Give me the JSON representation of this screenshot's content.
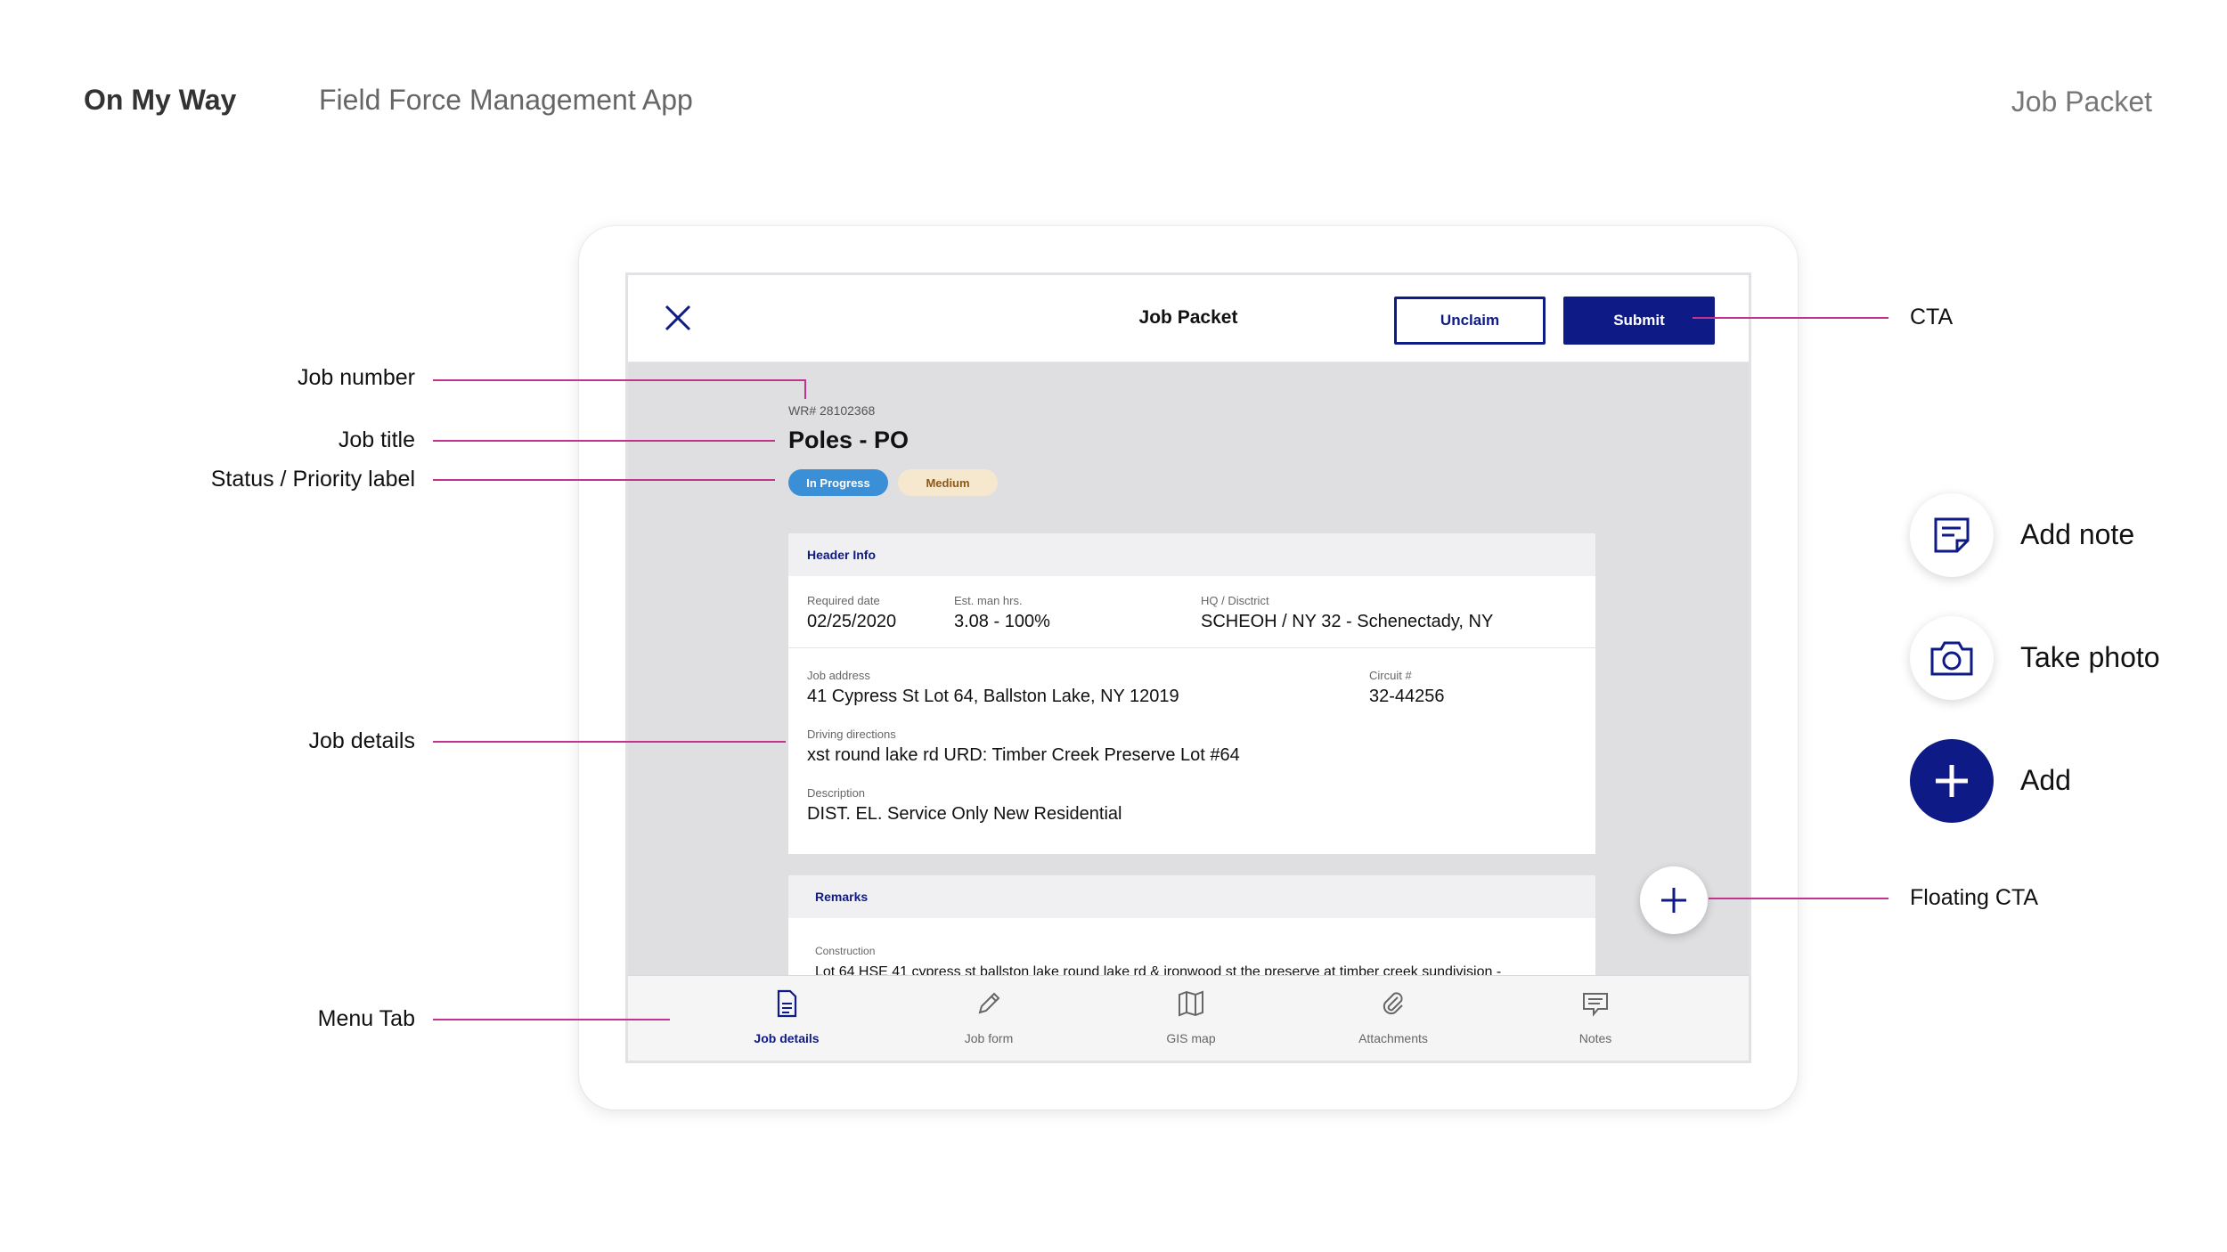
{
  "presentation": {
    "brand": "On My Way",
    "subtitle": "Field Force Management App",
    "section": "Job Packet"
  },
  "app": {
    "topbar": {
      "title": "Job Packet",
      "unclaim_label": "Unclaim",
      "submit_label": "Submit"
    },
    "job": {
      "number": "WR# 28102368",
      "title": "Poles - PO",
      "status": "In Progress",
      "priority": "Medium"
    },
    "header_info": {
      "title": "Header Info",
      "required_date_label": "Required date",
      "required_date": "02/25/2020",
      "man_hrs_label": "Est. man hrs.",
      "man_hrs": "3.08 - 100%",
      "hq_label": "HQ / Disctrict",
      "hq": "SCHEOH / NY 32 - Schenectady, NY",
      "address_label": "Job address",
      "address": "41 Cypress St Lot 64, Ballston Lake, NY 12019",
      "circuit_label": "Circuit #",
      "circuit": "32-44256",
      "directions_label": "Driving directions",
      "directions": "xst round lake rd URD: Timber Creek Preserve Lot #64",
      "description_label": "Description",
      "description": "DIST. EL. Service Only New Residential"
    },
    "remarks": {
      "title": "Remarks",
      "construction_label": "Construction",
      "construction": "Lot 64 HSE 41 cypress st ballston lake round lake rd & ironwood st the preserve at timber creek sundivision -"
    },
    "bottom_nav": [
      {
        "label": "Job details",
        "icon": "document-icon",
        "active": true
      },
      {
        "label": "Job form",
        "icon": "pencil-icon",
        "active": false
      },
      {
        "label": "GIS map",
        "icon": "map-icon",
        "active": false
      },
      {
        "label": "Attachments",
        "icon": "paperclip-icon",
        "active": false
      },
      {
        "label": "Notes",
        "icon": "notes-icon",
        "active": false
      }
    ]
  },
  "annotations": {
    "job_number": "Job number",
    "job_title": "Job title",
    "status_priority": "Status / Priority label",
    "job_details": "Job details",
    "menu_tab": "Menu Tab",
    "cta": "CTA",
    "floating_cta": "Floating CTA"
  },
  "legend": {
    "add_note": "Add note",
    "take_photo": "Take photo",
    "add": "Add"
  },
  "colors": {
    "primary": "#0e1a86",
    "status_blue": "#3a8fd6",
    "priority_bg": "#f6e7cf",
    "annotation": "#c2338f"
  }
}
